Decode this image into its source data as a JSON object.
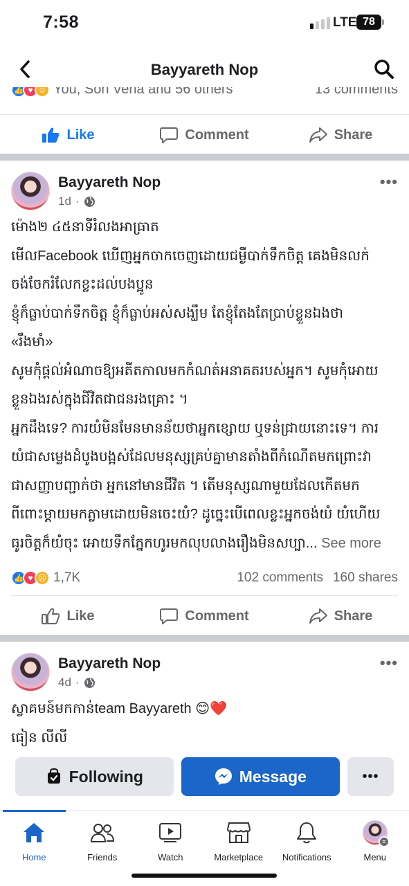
{
  "status": {
    "time": "7:58",
    "network": "LTE",
    "battery": "78"
  },
  "header": {
    "title": "Bayyareth Nop"
  },
  "previous_post": {
    "reactions_text": "You, Son Vena and 56 others",
    "comments_text": "13 comments",
    "actions": {
      "like": "Like",
      "comment": "Comment",
      "share": "Share"
    }
  },
  "post1": {
    "author": "Bayyareth Nop",
    "time": "1d",
    "body": [
      "ម៉ោង២ ៤៥នាទីរំលងអាធ្រាត",
      "មើលFacebook ឃើញអ្នកចាកចេញដោយជម្ងឺបាក់ទឹកចិត្ត គេងមិនលក់",
      "ចង់ចែករំលែកខ្លះដល់បងប្អូន",
      "ខ្ញុំក៏ធ្លាប់បាក់ទឹកចិត្ត ខ្ញុំក៏ធ្លាប់អស់សង្ឃឹម តែខ្ញុំតែងតែប្រាប់ខ្លួនឯងថា",
      "«រឹងមាំ»",
      "សូមកុំផ្តល់អំណាចឱ្យអតីតកាលមកកំណត់អនាគតរបស់អ្នក។ សូមកុំអោយ",
      "ខ្លួនឯងរស់ក្នុងជីវិតជាជនរងគ្រោះ ។",
      "អ្នកដឹងទេ? ការយំមិនមែនមានន័យថាអ្នកខ្សោយ ឬទន់ជ្រាយនោះទេ។ ការ",
      "យំជាសម្លេងដំបូងបង្អស់ដែលមនុស្សគ្រប់គ្នាមានតាំងពីកំណើតមកព្រោះវា",
      "ជាសញ្ញាបញ្ជាក់ថា អ្នកនៅមានជីវិត ។ តើមនុស្សណាមួយដែលកើតមក",
      "ពីពោះម្តាយមកភ្លាមដោយមិនចេះយំ? ដូច្នេះបើពេលខ្លះអ្នកចង់យំ យំហើយ"
    ],
    "last_line": "ធូរចិត្តក៏យំចុះ អោយទឹកភ្នែកហូរមកលុបលាងរឿងមិនសប្បា...",
    "see_more": "See more",
    "reactions_count": "1,7K",
    "comments": "102 comments",
    "shares": "160 shares",
    "actions": {
      "like": "Like",
      "comment": "Comment",
      "share": "Share"
    }
  },
  "post2": {
    "author": "Bayyareth Nop",
    "time": "4d",
    "body_line1": "ស្វាគមន៍មកកាន់team Bayyareth 😊❤️",
    "body_line2": "ធៀន លីលី"
  },
  "profile_actions": {
    "following": "Following",
    "message": "Message",
    "more": "•••"
  },
  "bottom_nav": {
    "items": [
      {
        "label": "Home",
        "icon": "home-icon"
      },
      {
        "label": "Friends",
        "icon": "friends-icon"
      },
      {
        "label": "Watch",
        "icon": "watch-icon"
      },
      {
        "label": "Marketplace",
        "icon": "marketplace-icon"
      },
      {
        "label": "Notifications",
        "icon": "bell-icon"
      },
      {
        "label": "Menu",
        "icon": "menu-avatar"
      }
    ]
  },
  "colors": {
    "brand_blue": "#1b66c9",
    "like_blue": "#1877f2",
    "secondary_text": "#65676b"
  }
}
